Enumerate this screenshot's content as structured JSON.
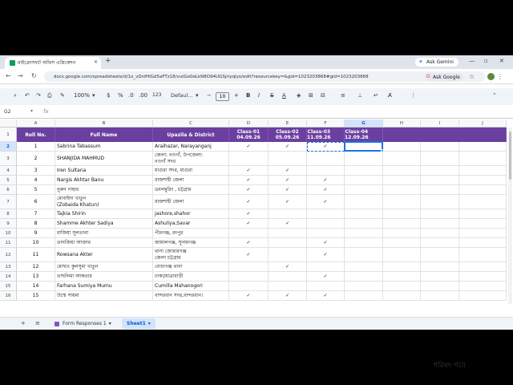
{
  "browser": {
    "tab_title": "মাইক্রোসফট অফিস এপ্লিকেশন",
    "new_tab": "+",
    "ask_gemini": "Ask Gemini",
    "url": "docs.google.com/spreadsheets/d/1o_vDnfHlGd5aFTz18/vutGo0eLkN8O94UGSjriyqlyo/edit?resourcekey=&gid=1023203868#gid=1023203868",
    "ask_google": "Ask Google"
  },
  "toolbar": {
    "zoom": "100%",
    "currency": "$",
    "percent": "%",
    "dec_decrease": ".0",
    "dec_increase": ".00",
    "number_format": "123",
    "font": "Defaul...",
    "font_size": "10",
    "bold": "B",
    "italic": "I",
    "strike": "S",
    "text_color": "A"
  },
  "formula_bar": {
    "name_box": "G2",
    "fx": "fx",
    "value": ""
  },
  "columns": [
    "A",
    "B",
    "C",
    "D",
    "E",
    "F",
    "G",
    "H",
    "I",
    "J"
  ],
  "selected_column": "G",
  "header_row": {
    "row_num": "1",
    "roll": "Roll No.",
    "name": "Full Name",
    "district": "Upazila & District",
    "class1": "Class-01\n04.09.26",
    "class2": "Class-02\n05.09.26",
    "class3": "Class-03\n11.09.26",
    "class4": "Class-04\n12.09.26"
  },
  "rows": [
    {
      "num": "2",
      "roll": "1",
      "name": "Sabrina Tabassum",
      "district": "Araihazar, Narayanganj",
      "d": "✓",
      "e": "✓",
      "f": "✓",
      "g": ""
    },
    {
      "num": "3",
      "roll": "2",
      "name": "SHANJIDA MAHMUD",
      "district": "জেলা: নওগাঁ, উপজেলা:\nনওগাঁ সদর",
      "d": "",
      "e": "",
      "f": "",
      "g": ""
    },
    {
      "num": "4",
      "roll": "3",
      "name": "Iren Sultana",
      "district": "মাগুরা সদর, মাগুরা",
      "d": "✓",
      "e": "✓",
      "f": "",
      "g": ""
    },
    {
      "num": "5",
      "roll": "4",
      "name": "Nargis Akhtar Banu",
      "district": "রাজশাহী জেলা",
      "d": "✓",
      "e": "✓",
      "f": "✓",
      "g": ""
    },
    {
      "num": "6",
      "roll": "5",
      "name": "নুরুন নাহার",
      "district": "ডবলমুরিং , চট্টগ্রাম",
      "d": "✓",
      "e": "✓",
      "f": "✓",
      "g": ""
    },
    {
      "num": "7",
      "roll": "6",
      "name": "মোবাইদা খাতুন\n(Zobaida Khatun)",
      "district": "রাজশাহী জেলা",
      "d": "✓",
      "e": "✓",
      "f": "✓",
      "g": ""
    },
    {
      "num": "8",
      "roll": "7",
      "name": "Tajkia Shirin",
      "district": "jashore,shahor",
      "d": "✓",
      "e": "",
      "f": "",
      "g": ""
    },
    {
      "num": "9",
      "roll": "8",
      "name": "Shamme Akhter Sadiya",
      "district": "Ashuliya,Savar",
      "d": "✓",
      "e": "✓",
      "f": "",
      "g": ""
    },
    {
      "num": "10",
      "roll": "9",
      "name": "রাজিয়া সুলতানা",
      "district": "পীরগঞ্জ, রংপুর",
      "d": "",
      "e": "",
      "f": "",
      "g": ""
    },
    {
      "num": "11",
      "roll": "10",
      "name": "তানজিয়া আক্তার",
      "district": "জামালগঞ্জ, সুনামগঞ্জ",
      "d": "✓",
      "e": "",
      "f": "✓",
      "g": ""
    },
    {
      "num": "12",
      "roll": "11",
      "name": "Rowsana Akter",
      "district": "থানা জোরারগঞ্জ\nজেলা চট্টগ্রাম",
      "d": "✓",
      "e": "",
      "f": "✓",
      "g": ""
    },
    {
      "num": "13",
      "roll": "12",
      "name": "মোছাঃ কুলসুমা খাতুন",
      "district": "বোচাগঞ্জ থানা",
      "d": "",
      "e": "✓",
      "f": "",
      "g": ""
    },
    {
      "num": "14",
      "roll": "13",
      "name": "তাছলিমা আকতার",
      "district": "ঢাকা/যাত্রাবাড়ী",
      "d": "",
      "e": "",
      "f": "✓",
      "g": ""
    },
    {
      "num": "15",
      "roll": "14",
      "name": "Farhana Sumiya Mumu",
      "district": "Cumilla Mahanogori",
      "d": "",
      "e": "",
      "f": "",
      "g": ""
    },
    {
      "num": "16",
      "roll": "15",
      "name": "উম্মে সায়মা",
      "district": "বান্দরবান সদর,বান্দরবান।",
      "d": "✓",
      "e": "✓",
      "f": "✓",
      "g": ""
    }
  ],
  "sheets": {
    "add": "+",
    "list": "≡",
    "form_responses": "Form Responses 1",
    "sheet1": "Sheet1"
  },
  "watermark": "পরিষদ গবে",
  "colors": {
    "header_purple": "#6b3fa0",
    "selection": "#1a73e8"
  }
}
